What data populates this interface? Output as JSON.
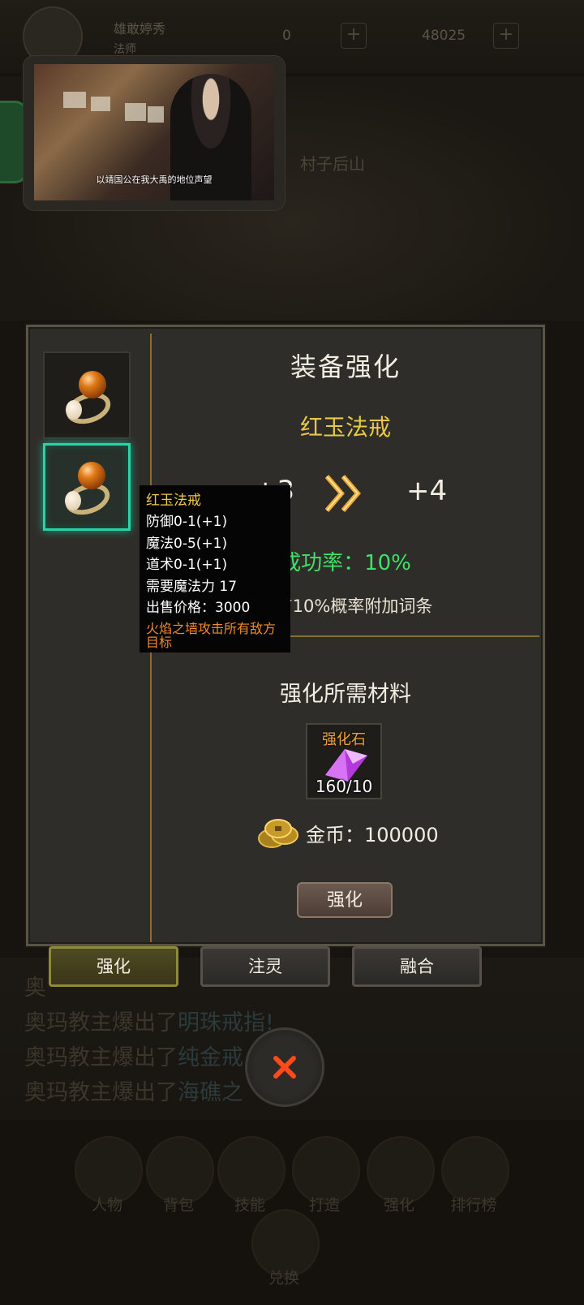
{
  "background": {
    "player_name": "雄敢婷秀",
    "player_class": "法师",
    "currency_a": "0",
    "currency_b": "48025",
    "map_label": "村子后山",
    "log_lines": [
      {
        "prefix": "奥",
        "item": ""
      },
      {
        "prefix": "奥玛教主爆出了",
        "item": "明珠戒指!"
      },
      {
        "prefix": "奥玛教主爆出了",
        "item": "纯金戒"
      },
      {
        "prefix": "奥玛教主爆出了",
        "item": "海礁之"
      }
    ],
    "nav": [
      "人物",
      "背包",
      "技能",
      "打造",
      "强化",
      "排行榜"
    ],
    "nav_exchange": "兑换"
  },
  "video": {
    "subtitle": "以靖国公在我大禹的地位声望"
  },
  "dialog": {
    "title": "装备强化",
    "item_name": "红玉法戒",
    "level_from": "+3",
    "level_to": "+4",
    "success_rate": "成功率：10%",
    "bonus_text": "均有10%概率附加词条",
    "materials_title": "强化所需材料",
    "stone_label": "强化石",
    "stone_count": "160/10",
    "gold_text": "金币：100000",
    "enhance_button": "强化",
    "slots": [
      {
        "icon": "ring-icon",
        "selected": false
      },
      {
        "icon": "ring-icon",
        "selected": true
      }
    ]
  },
  "tooltip": {
    "name": "红玉法戒",
    "lines": [
      "防御0-1(+1)",
      "魔法0-5(+1)",
      "道术0-1(+1)",
      "需要魔法力 17",
      "出售价格：3000"
    ],
    "effect": "火焰之墙攻击所有敌方目标"
  },
  "tabs": [
    "强化",
    "注灵",
    "融合"
  ],
  "active_tab": "强化",
  "colors": {
    "item_name": "#e7c84a",
    "success": "#3fe068",
    "tooltip_effect": "#f08a2a",
    "selected_slot": "#28d3a8"
  }
}
